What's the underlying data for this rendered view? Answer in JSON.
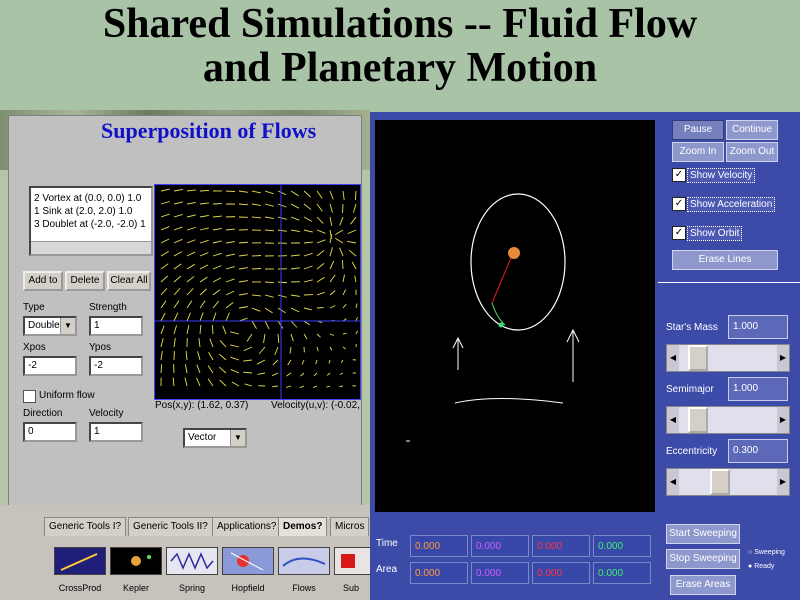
{
  "slide_title_line1": "Shared Simulations -- Fluid Flow",
  "slide_title_line2": "and Planetary Motion",
  "flow_app": {
    "heading": "Superposition of Flows",
    "flows_list": [
      "2  Vortex at (0.0, 0.0) 1.0",
      "1  Sink at (2.0, 2.0) 1.0",
      "3  Doublet at (-2.0, -2.0) 1"
    ],
    "add_label": "Add to",
    "delete_label": "Delete",
    "clear_label": "Clear All",
    "type_label": "Type",
    "type_value": "Doublet",
    "strength_label": "Strength",
    "strength_value": "1",
    "xpos_label": "Xpos",
    "xpos_value": "-2",
    "ypos_label": "Ypos",
    "ypos_value": "-2",
    "uniform_flow_label": "Uniform flow",
    "direction_label": "Direction",
    "direction_value": "0",
    "velocity_label": "Velocity",
    "velocity_value": "1",
    "pos_readout": "Pos(x,y):  (1.62, 0.37)",
    "velocity_readout": "Velocity(u,v): (-0.02,",
    "display_mode": "Vector"
  },
  "taskbar": {
    "tabs": [
      "Generic Tools I?",
      "Generic Tools II?",
      "Applications?",
      "Demos?",
      "Micros"
    ],
    "demos": [
      "CrossProd",
      "Kepler",
      "Spring",
      "Hopfield",
      "Flows",
      "Sub"
    ]
  },
  "orbit_app": {
    "pause_label": "Pause",
    "continue_label": "Continue",
    "zoom_in_label": "Zoom In",
    "zoom_out_label": "Zoom Out",
    "show_velocity_label": "Show Velocity",
    "show_acceleration_label": "Show Acceleration",
    "show_orbit_label": "Show Orbit",
    "check_mark": "✓",
    "erase_lines_label": "Erase Lines",
    "star_mass_label": "Star's Mass",
    "star_mass_value": "1.000",
    "semimajor_label": "Semimajor",
    "semimajor_value": "1.000",
    "eccentricity_label": "Eccentricity",
    "eccentricity_value": "0.300",
    "slider_positions": {
      "star_mass": 0.12,
      "semimajor": 0.12,
      "eccentricity": 0.4
    },
    "time_label": "Time",
    "area_label": "Area",
    "time_values": [
      "0.000",
      "0.000",
      "0.000",
      "0.000"
    ],
    "area_values": [
      "0.000",
      "0.000",
      "0.000",
      "0.000"
    ],
    "value_colors": [
      "#ff9a3c",
      "#d45cff",
      "#ff3344",
      "#3cf06c"
    ],
    "start_sweeping_label": "Start Sweeping",
    "stop_sweeping_label": "Stop Sweeping",
    "erase_areas_label": "Erase Areas",
    "legend_sweeping": "Sweeping",
    "legend_ready": "Ready",
    "left_arrow": "◀",
    "right_arrow": "▶"
  }
}
